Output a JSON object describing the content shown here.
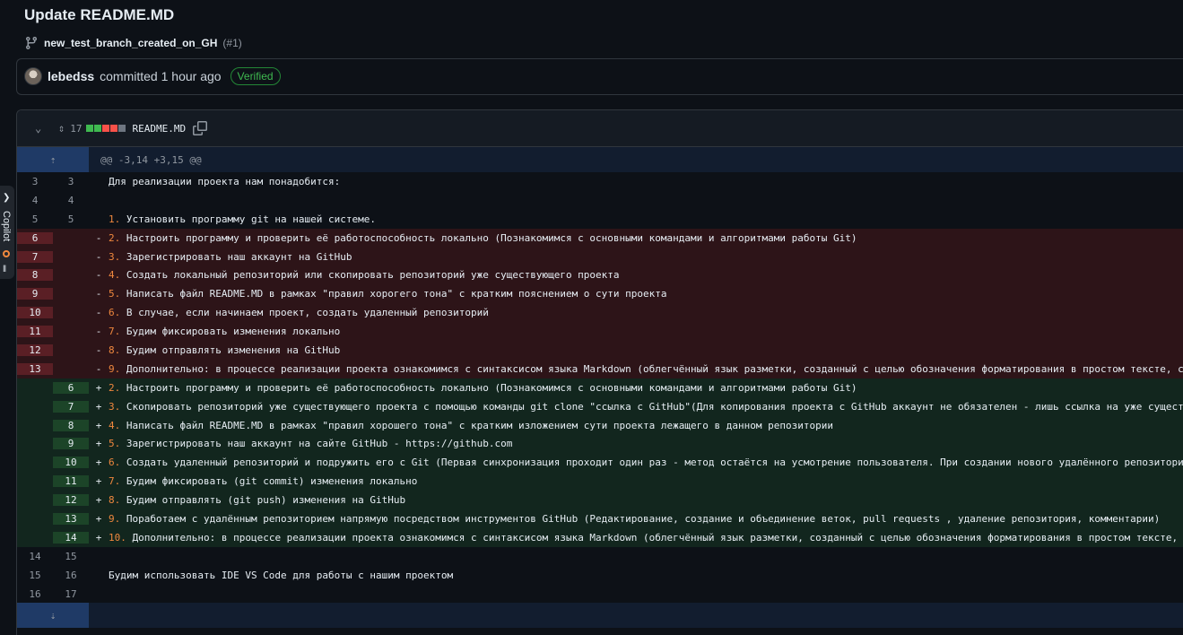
{
  "commit": {
    "title": "Update README.MD",
    "branch": "new_test_branch_created_on_GH",
    "pr_ref": "(#1)",
    "author": "lebedss",
    "committed": "committed 1 hour ago",
    "verified": "Verified"
  },
  "file": {
    "changes": "17",
    "name": "README.MD",
    "diffstat_colors": [
      "#3fb950",
      "#3fb950",
      "#f85149",
      "#f85149",
      "#6e7681"
    ]
  },
  "side_tab": {
    "label": "Copilot"
  },
  "diff": {
    "hunk_header": "@@ -3,14 +3,15 @@",
    "rows": [
      {
        "type": "ctx",
        "old": "3",
        "new": "3",
        "sign": "",
        "marker": "",
        "text": "Для реализации проекта нам понадобится:"
      },
      {
        "type": "ctx",
        "old": "4",
        "new": "4",
        "sign": "",
        "marker": "",
        "text": ""
      },
      {
        "type": "ctx",
        "old": "5",
        "new": "5",
        "sign": "",
        "marker": "1.",
        "text": " Установить программу git на нашей системе."
      },
      {
        "type": "del",
        "old": "6",
        "new": "",
        "sign": "-",
        "marker": "2.",
        "text": " Настроить программу и проверить её работоспособность локально (Познакомимся с основными командами и алгоритмами работы Git)"
      },
      {
        "type": "del",
        "old": "7",
        "new": "",
        "sign": "-",
        "marker": "3.",
        "text": " Зарегистрировать наш аккаунт на GitHub"
      },
      {
        "type": "del",
        "old": "8",
        "new": "",
        "sign": "-",
        "marker": "4.",
        "text": " Создать локальный репозиторий или скопировать репозиторий уже существующего проекта"
      },
      {
        "type": "del",
        "old": "9",
        "new": "",
        "sign": "-",
        "marker": "5.",
        "text": " Написать файл README.MD в рамках \"правил хорогего тона\" с кратким пояснением о сути проекта"
      },
      {
        "type": "del",
        "old": "10",
        "new": "",
        "sign": "-",
        "marker": "6.",
        "text": " В случае, если начинаем проект, создать удаленный репозиторий"
      },
      {
        "type": "del",
        "old": "11",
        "new": "",
        "sign": "-",
        "marker": "7.",
        "text": " Будим фиксировать изменения локально"
      },
      {
        "type": "del",
        "old": "12",
        "new": "",
        "sign": "-",
        "marker": "8.",
        "text": " Будим отправлять изменения на GitHub"
      },
      {
        "type": "del",
        "old": "13",
        "new": "",
        "sign": "-",
        "marker": "9.",
        "text": " Дополнительно: в процессе реализации проекта ознакомимся с синтаксисом языка Markdown (облегчённый язык разметки, созданный с целью обозначения форматирования в простом тексте, с"
      },
      {
        "type": "add",
        "old": "",
        "new": "6",
        "sign": "+",
        "marker": "2.",
        "text": " Настроить программу и проверить её работоспособность локально (Познакомимся с основными командами и алгоритмами работы Git)"
      },
      {
        "type": "add",
        "old": "",
        "new": "7",
        "sign": "+",
        "marker": "3.",
        "text": " Скопировать репозиторий уже существующего проекта с помощью команды git clone \"ссылка с GitHub\"(Для копирования проекта с GitHub аккаунт не обязателен - лишь ссылка на уже существ"
      },
      {
        "type": "add",
        "old": "",
        "new": "8",
        "sign": "+",
        "marker": "4.",
        "text": " Написать файл README.MD в рамках \"правил хорошего тона\" с кратким изложением сути проекта лежащего в данном репозитории"
      },
      {
        "type": "add",
        "old": "",
        "new": "9",
        "sign": "+",
        "marker": "5.",
        "text": " Зарегистрировать наш аккаунт на сайте GitHub - https://github.com"
      },
      {
        "type": "add",
        "old": "",
        "new": "10",
        "sign": "+",
        "marker": "6.",
        "text": " Создать удаленный репозиторий и подружить его с Git (Первая синхронизация проходит один раз - метод остаётся на усмотрение пользователя. При создании нового удалённого репозитория"
      },
      {
        "type": "add",
        "old": "",
        "new": "11",
        "sign": "+",
        "marker": "7.",
        "text": " Будим фиксировать (git commit) изменения локально"
      },
      {
        "type": "add",
        "old": "",
        "new": "12",
        "sign": "+",
        "marker": "8.",
        "text": " Будим отправлять (git push) изменения на GitHub"
      },
      {
        "type": "add",
        "old": "",
        "new": "13",
        "sign": "+",
        "marker": "9.",
        "text": " Поработаем с удалённым репозиторием напрямую посредством инструментов GitHub (Редактирование, создание и объединение веток, pull requests , удаление репозитория, комментарии)"
      },
      {
        "type": "add",
        "old": "",
        "new": "14",
        "sign": "+",
        "marker": "10.",
        "text": " Дополнительно: в процессе реализации проекта ознакомимся с синтаксисом языка Markdown (облегчённый язык разметки, созданный с целью обозначения форматирования в простом тексте, с"
      },
      {
        "type": "ctx",
        "old": "14",
        "new": "15",
        "sign": "",
        "marker": "",
        "text": ""
      },
      {
        "type": "ctx",
        "old": "15",
        "new": "16",
        "sign": "",
        "marker": "",
        "text": "Будим использовать IDE VS Code для работы с нашим проектом"
      },
      {
        "type": "ctx",
        "old": "16",
        "new": "17",
        "sign": "",
        "marker": "",
        "text": ""
      }
    ]
  }
}
